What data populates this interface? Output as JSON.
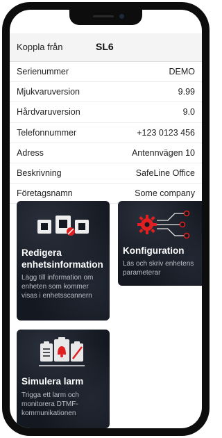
{
  "topbar": {
    "disconnect_label": "Koppla från",
    "device_name": "SL6"
  },
  "info_rows": [
    {
      "label": "Serienummer",
      "value": "DEMO"
    },
    {
      "label": "Mjukvaruversion",
      "value": "9.99"
    },
    {
      "label": "Hårdvaruversion",
      "value": "9.0"
    },
    {
      "label": "Telefonnummer",
      "value": "+123 0123 456"
    },
    {
      "label": "Adress",
      "value": "Antennvägen 10"
    },
    {
      "label": "Beskrivning",
      "value": "SafeLine Office"
    },
    {
      "label": "Företagsnamn",
      "value": "Some company"
    }
  ],
  "cards": [
    {
      "title": "Redigera enhetsinformation",
      "description": "Lägg till information om enheten som kommer visas i enhetsscannern"
    },
    {
      "title": "Konfiguration",
      "description": "Läs och skriv enhetens parameterar"
    },
    {
      "title": "Simulera larm",
      "description": "Trigga ett larm och monitorera DTMF-kommunikationen"
    }
  ],
  "colors": {
    "accent": "#e02020",
    "card_bg": "#141820",
    "frame": "#0d0d0d"
  },
  "icons": {
    "edit": "device-boxes-icon",
    "config": "gear-circuit-icon",
    "alarm": "clipboard-bell-icon"
  }
}
